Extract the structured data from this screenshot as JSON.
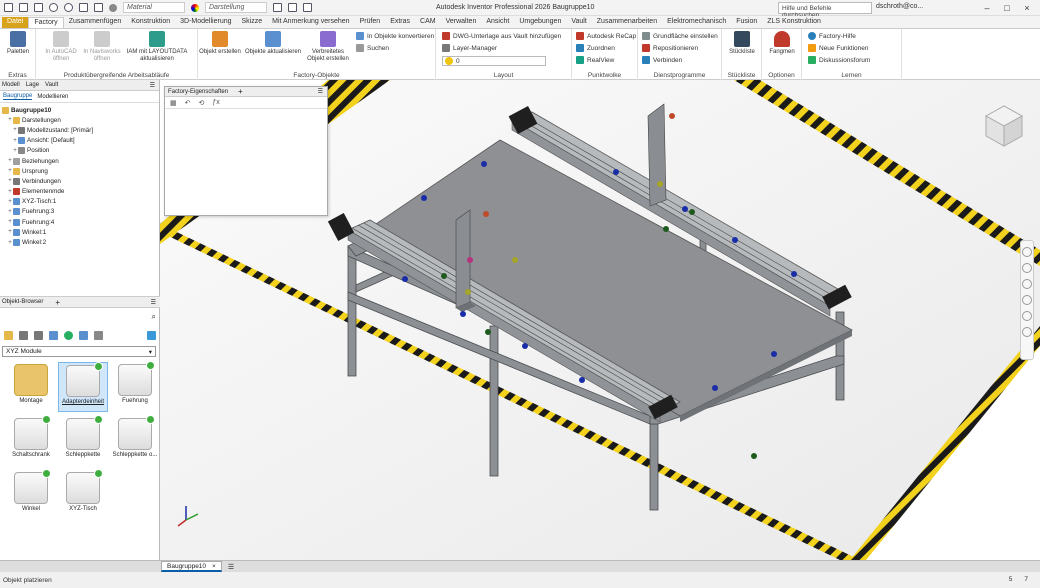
{
  "app": {
    "title": "Autodesk Inventor Professional 2026   Baugruppe10",
    "search_placeholder": "Hilfe und Befehle durchsuchen...",
    "user": "dschroth@co..."
  },
  "quickaccess": {
    "material": "Material",
    "appearance": "Darstellung"
  },
  "menu": [
    "Datei",
    "Factory",
    "Zusammenfügen",
    "Konstruktion",
    "3D-Modellierung",
    "Skizze",
    "Mit Anmerkung versehen",
    "Prüfen",
    "Extras",
    "CAM",
    "Verwalten",
    "Ansicht",
    "Umgebungen",
    "Vault",
    "Zusammenarbeiten",
    "Elektromechanisch",
    "Fusion",
    "ZLS Konstruktion"
  ],
  "ribbon": {
    "extras": {
      "label": "Extras",
      "paletten": "Paletten"
    },
    "arbeitsablaeufe": {
      "label": "Produktübergreifende Arbeitsabläufe",
      "autocad": "In AutoCAD öffnen",
      "navisworks": "In Navisworks öffnen",
      "iam": "IAM mit LAYOUTDATA aktualisieren"
    },
    "factory_objekte": {
      "label": "Factory-Objekte",
      "erstellen": "Objekt erstellen",
      "aktualisieren": "Objekte aktualisieren",
      "verbinden": "Verbreitetes Objekt erstellen",
      "konvertieren": "In Objekte konvertieren",
      "suchen": "Suchen"
    },
    "layout": {
      "label": "Layout",
      "dwg": "DWG-Unterlage aus Vault hinzufügen",
      "layer": "Layer-Manager",
      "layer_value": "0"
    },
    "punktwolke": {
      "label": "Punktwolke",
      "recap": "Autodesk ReCap",
      "zuordnen": "Zuordnen",
      "realview": "RealView"
    },
    "dienstprogramme": {
      "label": "Dienstprogramme",
      "grundflaeche": "Grundfläche einstellen",
      "repositionieren": "Repositionieren",
      "verbinden": "Verbinden"
    },
    "stueckliste": {
      "label": "Stückliste",
      "btn": "Stückliste"
    },
    "optionen": {
      "label": "Optionen",
      "btn": "Fangmen"
    },
    "lernen": {
      "label": "Lernen",
      "hilfe": "Factory-Hilfe",
      "neu": "Neue Funktionen",
      "forum": "Diskussionsforum"
    }
  },
  "model_panel": {
    "tabs": [
      "Modell",
      "Lage",
      "Vault"
    ],
    "subtabs": [
      "Baugruppe",
      "Modellieren"
    ],
    "root": "Baugruppe10",
    "items": [
      "Darstellungen",
      "Modellzustand: [Primär]",
      "Ansicht: [Default]",
      "Position",
      "Beziehungen",
      "Ursprung",
      "Verbindungen",
      "Elementenmde",
      "XYZ-Tisch:1",
      "Fuehrung:3",
      "Fuehrung:4",
      "Winkel:1",
      "Winkel:2"
    ]
  },
  "properties_panel": {
    "title": "Factory-Eigenschaften"
  },
  "object_browser": {
    "title": "Objekt-Browser",
    "category": "XYZ Module",
    "tiles": [
      "Montage",
      "Adapterdeinheit",
      "Fuehrung",
      "Schaltschrank",
      "Schleppkette",
      "Schleppkette o...",
      "Winkel",
      "XYZ-Tisch"
    ]
  },
  "document_tab": "Baugruppe10",
  "status": {
    "message": "Objekt platzieren",
    "count_a": "5",
    "count_b": "7"
  }
}
